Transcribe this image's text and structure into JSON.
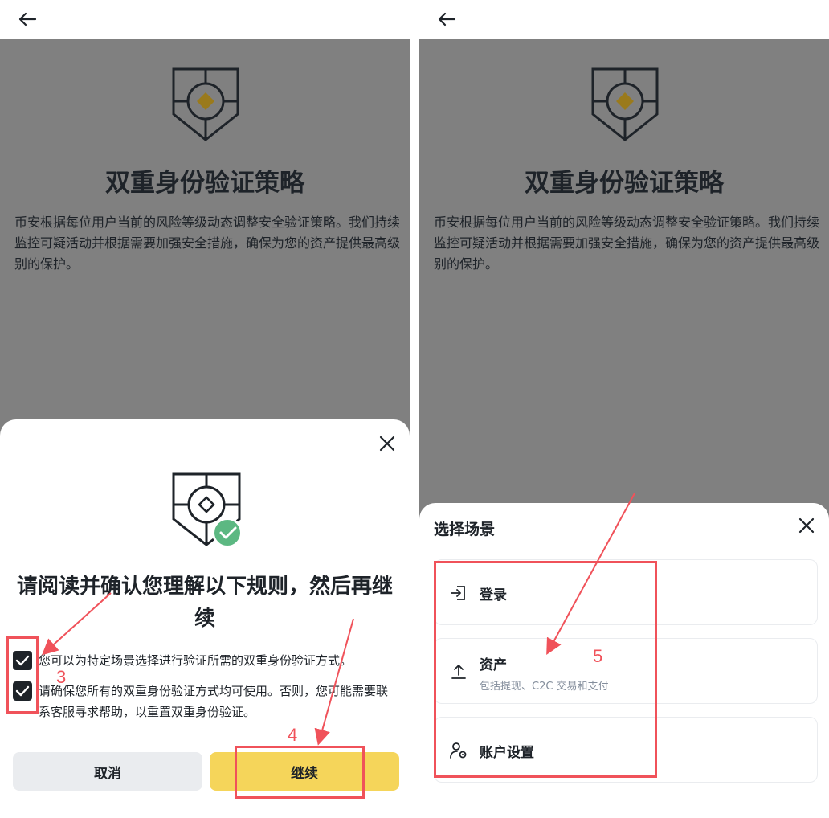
{
  "colors": {
    "overlay": "#808080",
    "accent_yellow": "#f5d55a",
    "success_green": "#5cb882",
    "annotation_red": "#f0525a",
    "shield_gold": "#9a7a1c"
  },
  "left": {
    "back_icon": "arrow-left-icon",
    "background": {
      "title": "双重身份验证策略",
      "description": "币安根据每位用户当前的风险等级动态调整安全验证策略。我们持续监控可疑活动并根据需要加强安全措施，确保为您的资产提供最高级别的保护。"
    },
    "sheet": {
      "close_icon": "close-icon",
      "title": "请阅读并确认您理解以下规则，然后再继续",
      "rules": [
        {
          "text": "您可以为特定场景选择进行验证所需的双重身份验证方式。",
          "checked": true
        },
        {
          "text": "请确保您所有的双重身份验证方式均可使用。否则，您可能需要联系客服寻求帮助，以重置双重身份验证。",
          "checked": true
        }
      ],
      "cancel_label": "取消",
      "continue_label": "继续"
    },
    "annotations": {
      "step_checkboxes": "3",
      "step_continue": "4"
    }
  },
  "right": {
    "back_icon": "arrow-left-icon",
    "background": {
      "title": "双重身份验证策略",
      "description": "币安根据每位用户当前的风险等级动态调整安全验证策略。我们持续监控可疑活动并根据需要加强安全措施，确保为您的资产提供最高级别的保护。"
    },
    "sheet": {
      "title": "选择场景",
      "close_icon": "close-icon",
      "scenes": [
        {
          "label": "登录",
          "subtitle": "",
          "icon": "login-icon"
        },
        {
          "label": "资产",
          "subtitle": "包括提现、C2C 交易和支付",
          "icon": "upload-icon"
        },
        {
          "label": "账户设置",
          "subtitle": "",
          "icon": "user-settings-icon"
        }
      ]
    },
    "annotations": {
      "step_scenes": "5"
    }
  }
}
